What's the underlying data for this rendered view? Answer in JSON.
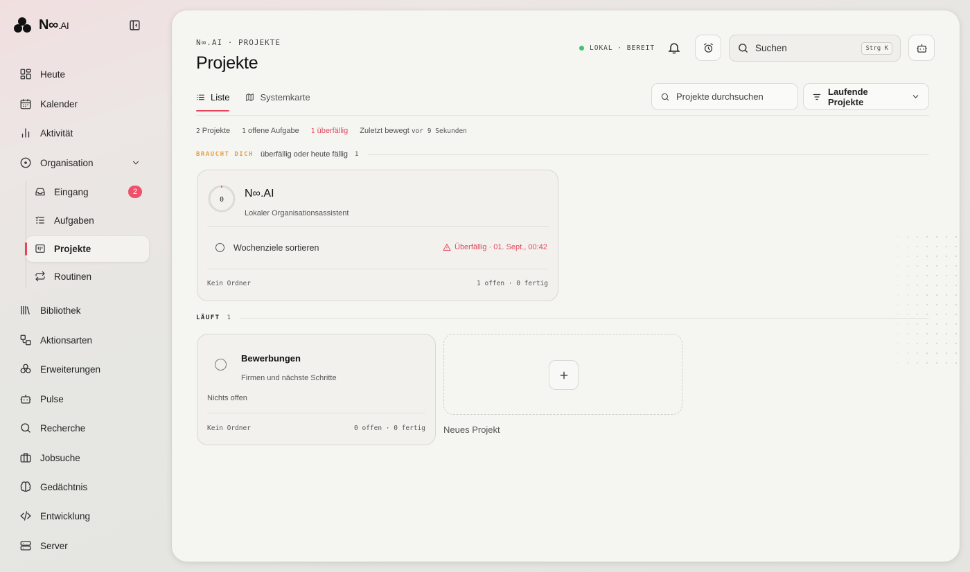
{
  "app": {
    "brand": "N∞",
    "brand_suffix": ".AI"
  },
  "sidebar": {
    "items": [
      {
        "label": "Heute",
        "icon": "dashboard-grid-icon"
      },
      {
        "label": "Kalender",
        "icon": "calendar-icon"
      },
      {
        "label": "Aktivität",
        "icon": "bar-chart-icon"
      },
      {
        "label": "Organisation",
        "icon": "compass-icon"
      },
      {
        "label": "Bibliothek",
        "icon": "library-icon"
      },
      {
        "label": "Aktionsarten",
        "icon": "shapes-icon"
      },
      {
        "label": "Erweiterungen",
        "icon": "puzzle-cubes-icon"
      },
      {
        "label": "Pulse",
        "icon": "robot-icon"
      },
      {
        "label": "Recherche",
        "icon": "search-icon"
      },
      {
        "label": "Jobsuche",
        "icon": "briefcase-icon"
      },
      {
        "label": "Gedächtnis",
        "icon": "brain-icon"
      },
      {
        "label": "Entwicklung",
        "icon": "code-icon"
      },
      {
        "label": "Server",
        "icon": "server-icon"
      }
    ],
    "sub_items": [
      {
        "label": "Eingang",
        "icon": "inbox-icon",
        "badge": "2"
      },
      {
        "label": "Aufgaben",
        "icon": "checklist-icon"
      },
      {
        "label": "Projekte",
        "icon": "kanban-icon",
        "active": true
      },
      {
        "label": "Routinen",
        "icon": "repeat-icon"
      }
    ]
  },
  "header": {
    "breadcrumb": "N∞.AI · PROJEKTE",
    "title": "Projekte",
    "status": "LOKAL · BEREIT",
    "search_placeholder": "Suchen",
    "search_shortcut": "Strg K"
  },
  "tabs": [
    {
      "label": "Liste",
      "active": true
    },
    {
      "label": "Systemkarte",
      "active": false
    }
  ],
  "toolbar": {
    "search_placeholder": "Projekte durchsuchen",
    "filter_label": "Laufende Projekte"
  },
  "stats": {
    "projects_num": "2",
    "projects_label": "Projekte",
    "open_num": "1",
    "open_label": "offene Aufgabe",
    "overdue_num": "1",
    "overdue_label": "überfällig",
    "moved_label": "Zuletzt bewegt",
    "moved_value": "vor 9 Sekunden"
  },
  "sections": {
    "needs_you": {
      "label": "BRAUCHT DICH",
      "desc": "überfällig oder heute fällig",
      "count": "1",
      "color": "#e8a040"
    },
    "running": {
      "label": "LÄUFT",
      "count": "1"
    }
  },
  "projects": [
    {
      "progress_label": "0",
      "progress": 0,
      "title": "N∞.AI",
      "subtitle": "Lokaler Organisationsassistent",
      "task": "Wochenziele sortieren",
      "task_due": "Überfällig · 01. Sept., 00:42",
      "folder": "Kein Ordner",
      "counts": "1 offen · 0 fertig"
    },
    {
      "title": "Bewerbungen",
      "subtitle": "Firmen und nächste Schritte",
      "empty": "Nichts offen",
      "folder": "Kein Ordner",
      "counts": "0 offen · 0 fertig"
    }
  ],
  "new_project": {
    "label": "Neues Projekt"
  },
  "colors": {
    "accent": "#e8455c",
    "status_ok": "#3bc56d",
    "overdue": "#e24a5f",
    "warn_label": "#e8a040"
  }
}
